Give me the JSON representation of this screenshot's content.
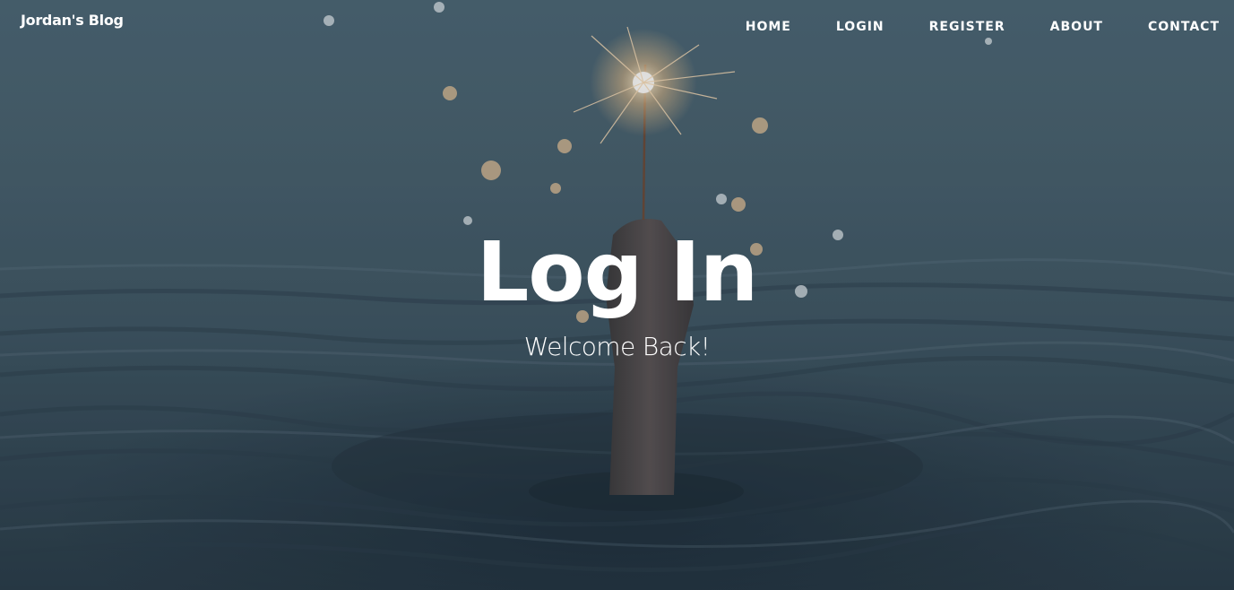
{
  "brand": {
    "name": "Jordan's Blog"
  },
  "nav": {
    "items": [
      {
        "label": "HOME"
      },
      {
        "label": "LOGIN"
      },
      {
        "label": "REGISTER"
      },
      {
        "label": "ABOUT"
      },
      {
        "label": "CONTACT"
      }
    ]
  },
  "header": {
    "title": "Log In",
    "subtitle": "Welcome Back!"
  },
  "colors": {
    "text": "#ffffff",
    "background_top": "#4c6674",
    "background_bottom": "#2a3c48"
  }
}
